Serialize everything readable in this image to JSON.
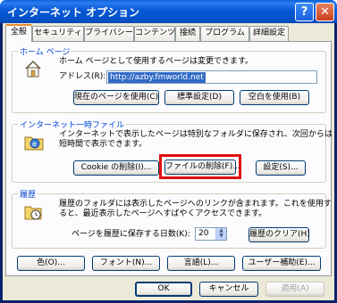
{
  "window": {
    "title": "インターネット オプション",
    "help_glyph": "?",
    "close_glyph": "✕"
  },
  "tabs": [
    {
      "label": "全般"
    },
    {
      "label": "セキュリティ"
    },
    {
      "label": "プライバシー"
    },
    {
      "label": "コンテンツ"
    },
    {
      "label": "接続"
    },
    {
      "label": "プログラム"
    },
    {
      "label": "詳細設定"
    }
  ],
  "home_page": {
    "title": "ホーム ページ",
    "description": "ホーム ページとして使用するページは変更できます。",
    "address_label": "アドレス(R):",
    "address_value": "http://azby.fmworld.net",
    "use_current": "現在のページを使用(C)",
    "use_default": "標準設定(D)",
    "use_blank": "空白を使用(B)"
  },
  "temp_files": {
    "title": "インターネット一時ファイル",
    "description_line1": "インターネットで表示したページは特別なフォルダに保存され、次回からは",
    "description_line2": "短時間で表示できます。",
    "delete_cookies": "Cookie の削除(I)...",
    "delete_files": "ファイルの削除(F)...",
    "settings": "設定(S)..."
  },
  "history": {
    "title": "履歴",
    "description_line1": "履歴のフォルダには表示したページへのリンクが含まれます。これを使用す",
    "description_line2": "ると、最近表示したページへすばやくアクセスできます。",
    "days_label": "ページを履歴に保存する日数(K):",
    "days_value": "20",
    "clear": "履歴のクリア(H)"
  },
  "bottom_buttons": {
    "colors": "色(O)...",
    "fonts": "フォント(N)...",
    "languages": "言語(L)...",
    "accessibility": "ユーザー補助(E)..."
  },
  "dialog_buttons": {
    "ok": "OK",
    "cancel": "キャンセル",
    "apply": "適用(A)"
  },
  "colors": {
    "title_bar": "#0658d6",
    "group_title": "#0046d5",
    "highlight": "#e01010",
    "dialog_bg": "#ece9d8",
    "selection": "#316ac5"
  }
}
